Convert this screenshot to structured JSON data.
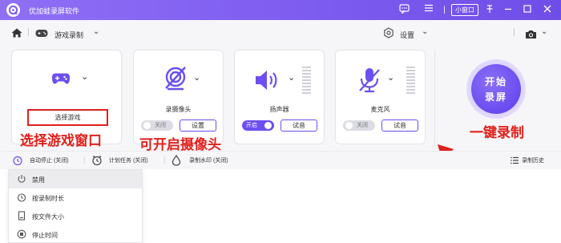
{
  "titlebar": {
    "app_title": "优加蛙录屏软件",
    "mini_mode": "小窗口",
    "icons": [
      "chat-icon",
      "menu-icon",
      "mini-window",
      "pin-icon",
      "minimize-icon",
      "close-icon"
    ],
    "accent": "#7d5cf0"
  },
  "toolbar": {
    "mode_label": "游戏录制",
    "settings_label": "设置"
  },
  "cards": {
    "game": {
      "button_label": "选择游戏"
    },
    "camera": {
      "label": "录摄像头",
      "toggle_label": "关闭",
      "toggle_on": false,
      "button_label": "设置"
    },
    "speaker": {
      "label": "扬声器",
      "toggle_label": "开启",
      "toggle_on": true,
      "button_label": "试音"
    },
    "mic": {
      "label": "麦克风",
      "toggle_label": "关闭",
      "toggle_on": false,
      "button_label": "试音"
    }
  },
  "record": {
    "line1": "开始",
    "line2": "录屏"
  },
  "annotations": {
    "select_game": "选择游戏窗口",
    "enable_camera": "可开启摄像头",
    "one_click": "一键录制",
    "color": "#e0201c"
  },
  "bottombar": {
    "auto_stop": "自动停止 (关闭)",
    "schedule": "计划任务 (关闭)",
    "watermark": "录制水印 (关闭)",
    "history": "录制历史"
  },
  "dropdown": {
    "items": [
      {
        "label": "禁用",
        "icon": "power-icon",
        "active": true
      },
      {
        "label": "按录制时长",
        "icon": "timer-icon",
        "active": false
      },
      {
        "label": "按文件大小",
        "icon": "file-icon",
        "active": false
      },
      {
        "label": "停止时间",
        "icon": "stop-icon",
        "active": false
      }
    ]
  }
}
